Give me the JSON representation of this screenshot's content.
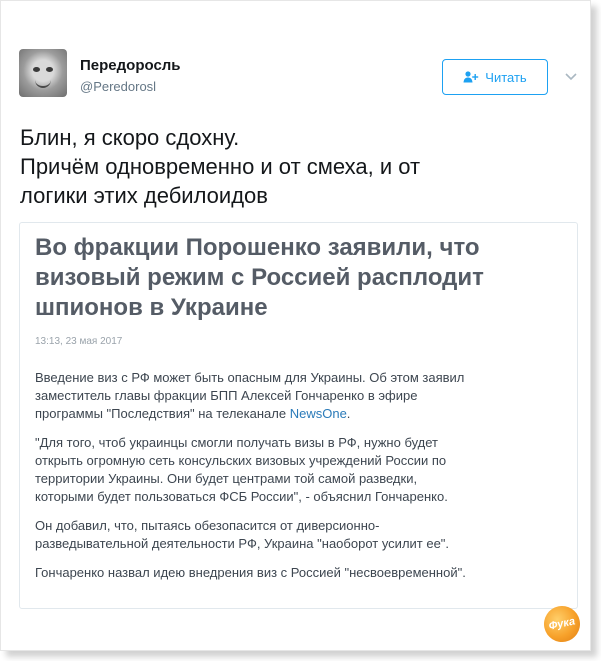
{
  "author": {
    "display_name": "Передоросль",
    "handle": "@Peredorosl"
  },
  "follow_button": {
    "label": "Читать"
  },
  "tweet": {
    "lines": [
      "Блин, я скоро сдохну.",
      "Причём одновременно и от смеха, и от",
      "логики этих дебилоидов"
    ]
  },
  "card": {
    "headline_lines": [
      "Во фракции Порошенко заявили, что",
      "визовый режим с Россией расплодит",
      "шпионов в Украине"
    ],
    "timestamp": "13:13, 23 мая 2017",
    "p1": {
      "line1": "Введение виз с РФ может быть опасным для Украины. Об этом заявил",
      "line2": "заместитель главы фракции БПП Алексей Гончаренко в эфире",
      "line3_prefix": "программы \"Последствия\" на телеканале ",
      "line3_link": "NewsOne",
      "line3_suffix": "."
    },
    "p2": [
      "\"Для того, чтоб украинцы смогли получать визы в РФ, нужно будет",
      "открыть огромную сеть консульских визовых учреждений России по",
      "территории Украины. Они будет центрами той самой разведки,",
      "которыми будет пользоваться ФСБ России\", - объяснил Гончаренко."
    ],
    "p3": [
      "Он добавил, что, пытаясь обезопасится от диверсионно-",
      "разведывательной деятельности РФ, Украина \"наоборот усилит ее\"."
    ],
    "p4": [
      "Гончаренко назвал идею внедрения виз с Россией \"несвоевременной\"."
    ]
  },
  "watermark": {
    "label": "Фука"
  },
  "colors": {
    "accent": "#1da1f2",
    "headline": "#555c66",
    "body": "#3d4650",
    "link": "#2b7bb9"
  },
  "icons": [
    "avatar-image",
    "person-plus-icon",
    "chevron-down-icon",
    "watermark-logo"
  ]
}
